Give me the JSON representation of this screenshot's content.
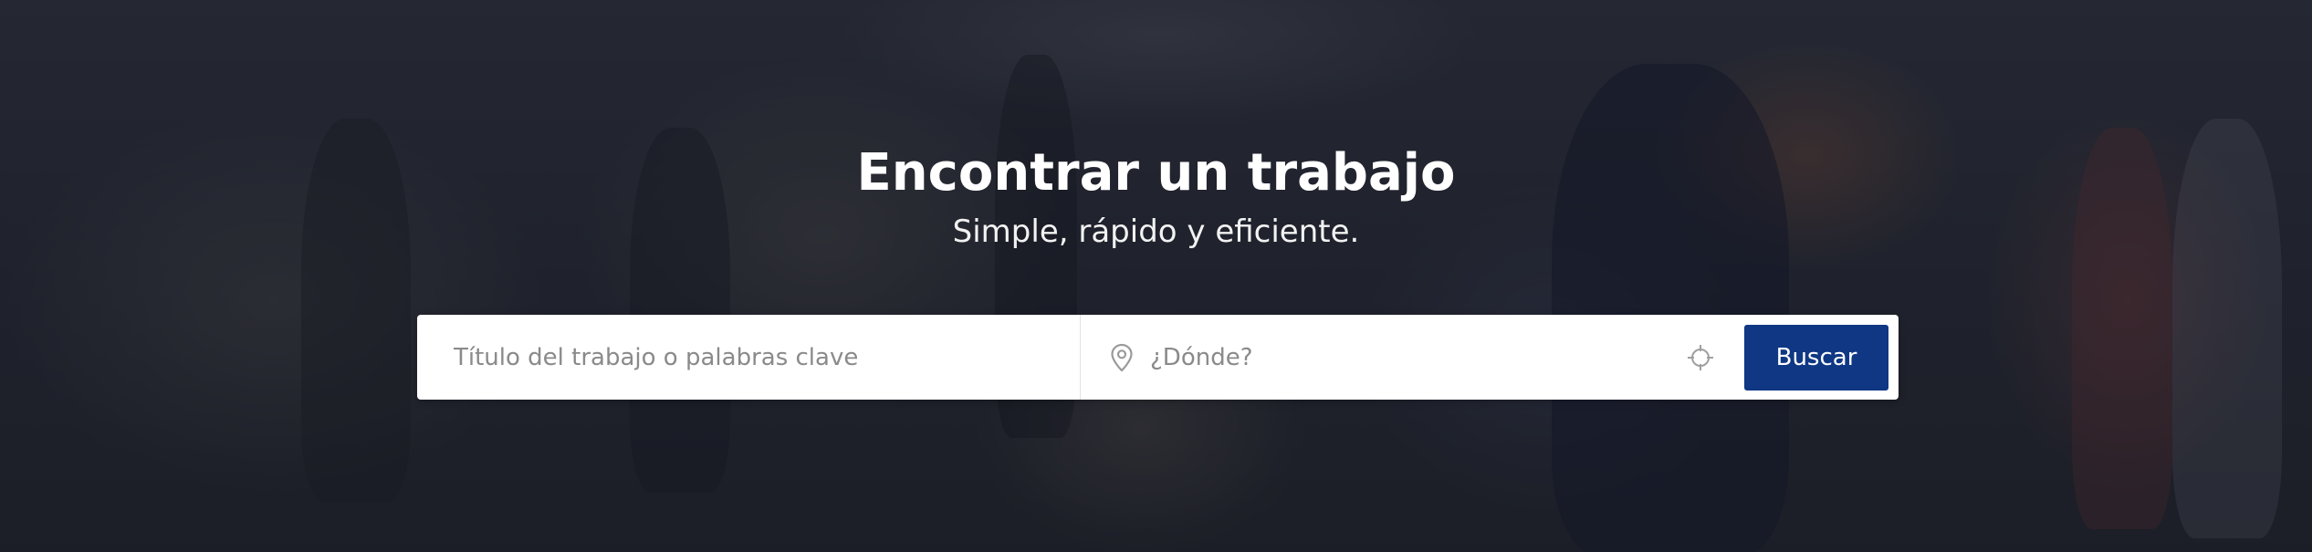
{
  "hero": {
    "title": "Encontrar un trabajo",
    "subtitle": "Simple, rápido y eficiente."
  },
  "search": {
    "keywords_placeholder": "Título del trabajo o palabras clave",
    "keywords_value": "",
    "location_placeholder": "¿Dónde?",
    "location_value": "",
    "button_label": "Buscar"
  },
  "icons": {
    "location_field": "map-pin-icon",
    "geolocate": "crosshair-icon"
  },
  "colors": {
    "button_bg": "#0f3783",
    "overlay": "#141826",
    "title_text": "#ffffff"
  }
}
